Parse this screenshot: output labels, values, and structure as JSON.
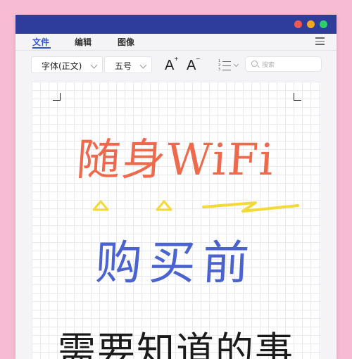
{
  "window": {
    "controls": [
      "close-dot",
      "minimize-dot",
      "maximize-dot"
    ]
  },
  "menu": {
    "items": [
      "文件",
      "编辑",
      "图像"
    ],
    "active": "文件"
  },
  "toolbar": {
    "font_family": "字体(正文)",
    "font_size": "五号",
    "grow_label": "A",
    "shrink_label": "A",
    "list_numbers": [
      "1",
      "2",
      "3"
    ],
    "search_placeholder": "搜索"
  },
  "document": {
    "line1": "随身WiFi",
    "line2": "购买前",
    "line3": "需要知道的事"
  },
  "colors": {
    "titlebar": "#2f3d9a",
    "line1": "#ef6a4c",
    "line2": "#4a63cf",
    "line3": "#1b1b1b",
    "accent_yellow": "#f3d93a"
  }
}
